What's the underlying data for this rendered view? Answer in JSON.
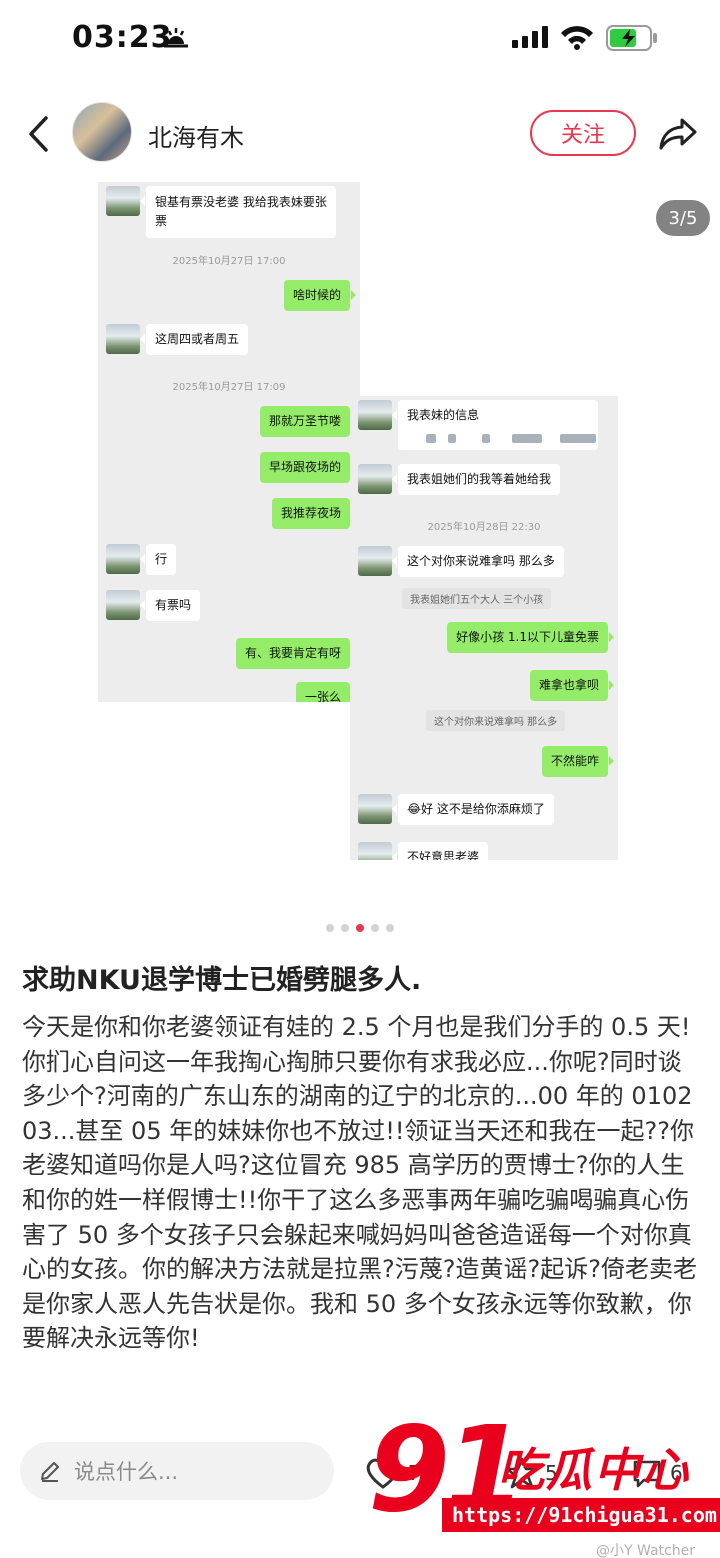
{
  "status": {
    "time": "03:23"
  },
  "header": {
    "username": "北海有木",
    "follow_label": "关注"
  },
  "carousel": {
    "counter": "3/5",
    "total": 5,
    "active_index": 2
  },
  "chat_left": {
    "m1": "银基有票没老婆 我给我表妹要张票",
    "m1a": "银基有票没老婆 我给我表妹要张",
    "m1b": "票",
    "ts1": "2025年10月27日 17:00",
    "m2": "啥时候的",
    "m3": "这周四或者周五",
    "ts2": "2025年10月27日 17:09",
    "m4": "那就万圣节喽",
    "m5": "早场跟夜场的",
    "m6": "我推荐夜场",
    "m7": "行",
    "m8": "有票吗",
    "m9": "有、我要肯定有呀",
    "m10": "一张么"
  },
  "chat_right": {
    "m1": "我表妹的信息",
    "m2": "我表姐她们的我等着她给我",
    "ts1": "2025年10月28日 22:30",
    "m3": "这个对你来说难拿吗 那么多",
    "q1": "我表姐她们五个大人 三个小孩",
    "m4": "好像小孩 1.1以下儿童免票",
    "m5": "难拿也拿呗",
    "q2": "这个对你来说难拿吗 那么多",
    "m6": "不然能咋",
    "m7": "😂好 这不是给你添麻烦了",
    "m8": "不好意思老婆"
  },
  "post": {
    "title": "求助NKU退学博士已婚劈腿多人.",
    "body": "今天是你和你老婆领证有娃的 2.5 个月也是我们分手的 0.5 天!你扪心自问这一年我掏心掏肺只要你有求我必应...你呢?同时谈多少个?河南的广东山东的湖南的辽宁的北京的...00 年的 010203...甚至 05 年的妹妹你也不放过!!领证当天还和我在一起??你老婆知道吗你是人吗?这位冒充 985 高学历的贾博士?你的人生和你的姓一样假博士!!你干了这么多恶事两年骗吃骗喝骗真心伤害了 50 多个女孩子只会躲起来喊妈妈叫爸爸造谣每一个对你真心的女孩。你的解决方法就是拉黑?污蔑?造黄谣?起诉?倚老卖老是你家人恶人先告状是你。我和 50 多个女孩永远等你致歉，你要解决永远等你!"
  },
  "bottom": {
    "comment_placeholder": "说点什么...",
    "like_count": "7",
    "star_count": "5",
    "comment_count": "6"
  },
  "watermark": {
    "big": "91",
    "name": "吃瓜中心",
    "url": "https://91chigua31.com",
    "credit": "@小Y Watcher"
  },
  "colors": {
    "accent": "#e8374f",
    "wechat_green": "#95ec69",
    "watermark_red": "#e8001c"
  }
}
